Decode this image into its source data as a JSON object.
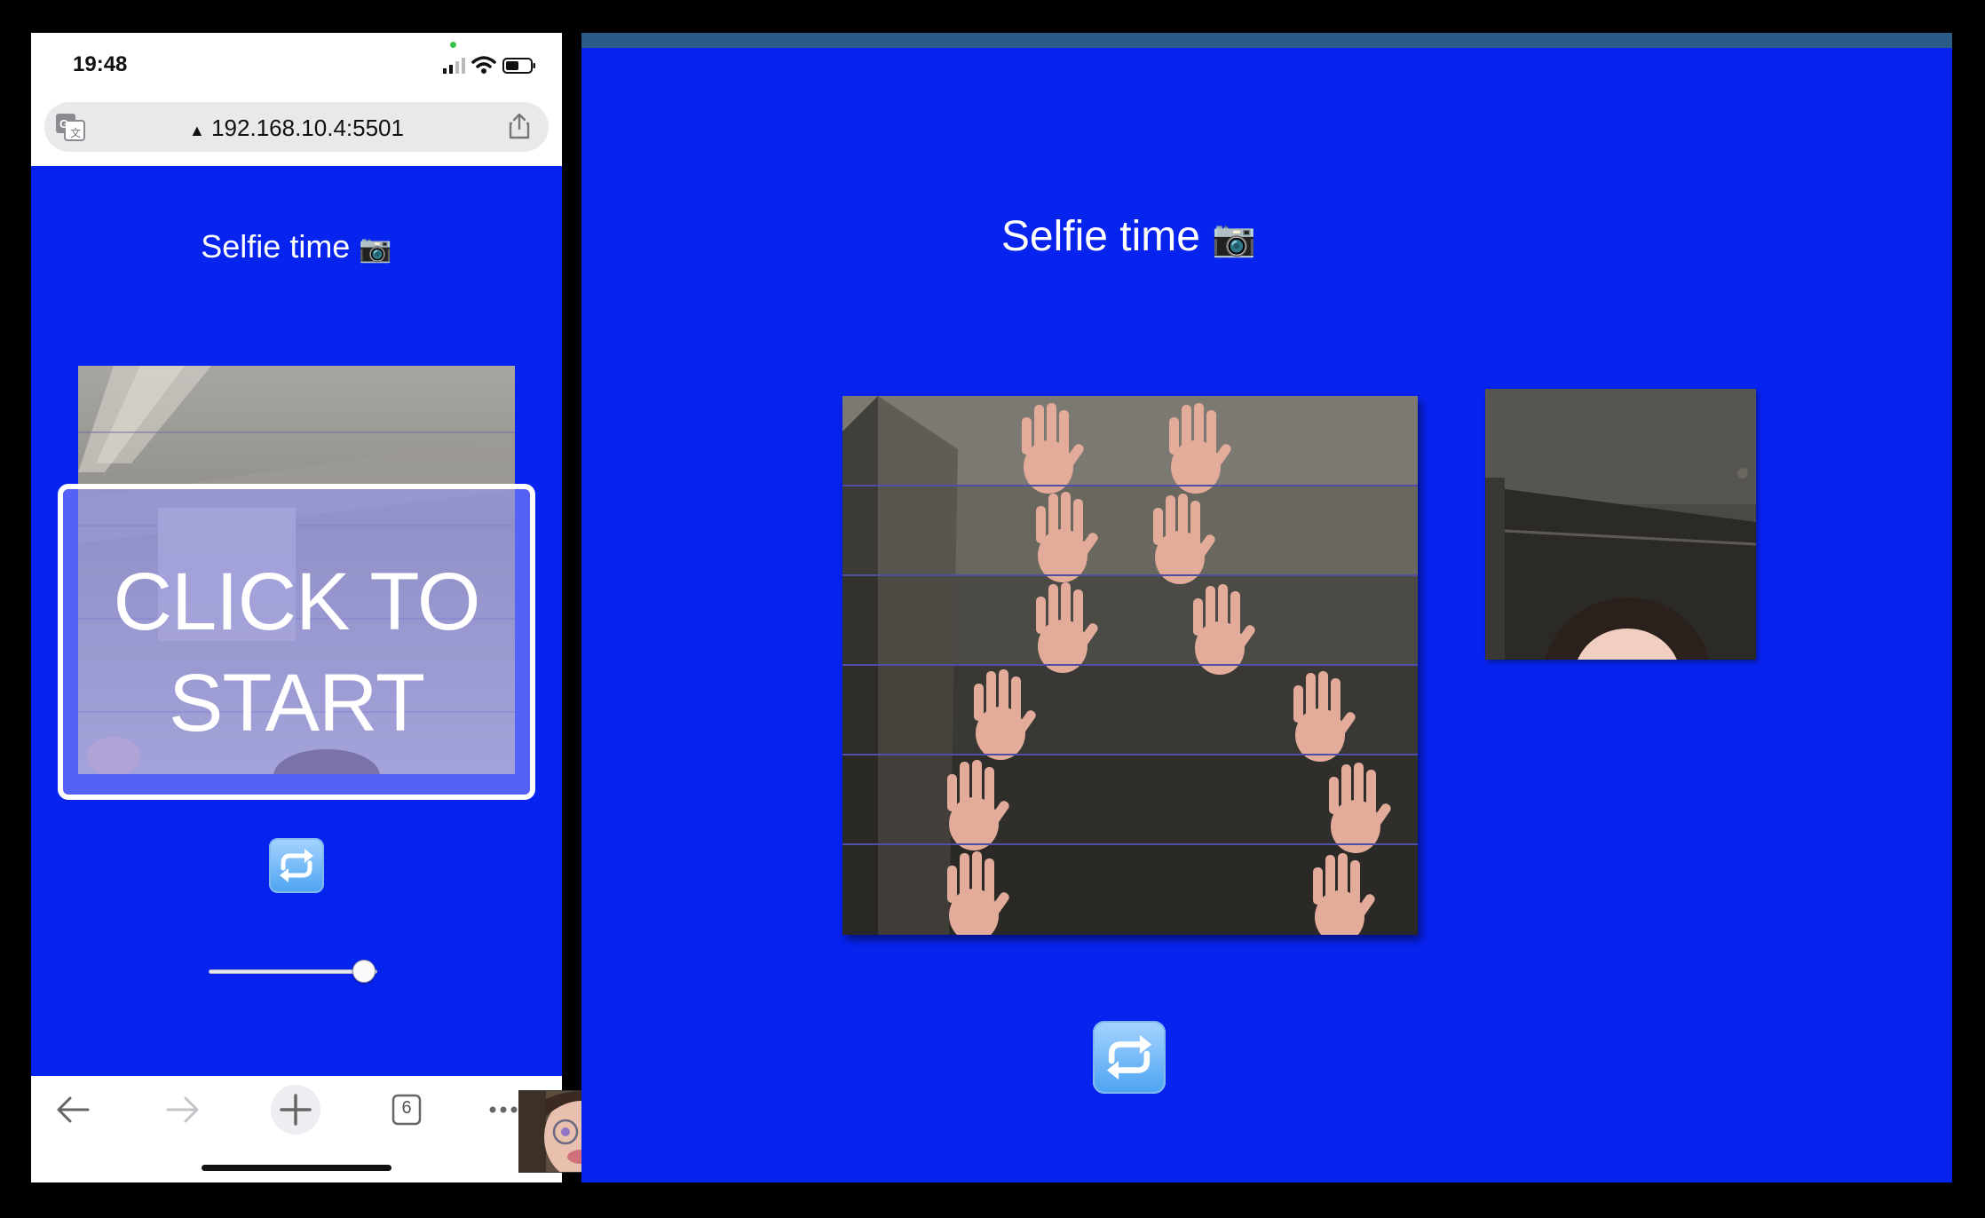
{
  "phone": {
    "status": {
      "time": "19:48"
    },
    "browser": {
      "url": "192.168.10.4:5501",
      "security_glyph": "warning-triangle-icon",
      "tab_count": "6"
    },
    "page": {
      "title": "Selfie time",
      "title_emoji": "📷",
      "start_button_label": "CLICK TO START",
      "repeat_emoji": "🔁",
      "slider_value_fraction": 0.92
    },
    "toolbar": {
      "icons": [
        "back-arrow-icon",
        "forward-arrow-icon",
        "plus-icon",
        "tabs-icon",
        "more-icon"
      ]
    }
  },
  "desktop": {
    "title": "Selfie time",
    "title_emoji": "📷",
    "repeat_emoji": "🔁",
    "collage_strip_count": 6
  },
  "colors": {
    "page_background": "#0723ee",
    "desktop_topbar": "#2a5b86",
    "text": "#ffffff"
  }
}
